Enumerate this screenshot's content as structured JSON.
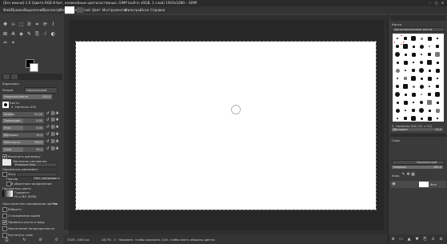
{
  "window": {
    "title": "[Без имени]-1.0 (Цвета RGB 8 бит, нелинейные цветосоставные, GIMP built-in sRGB, 1 слой) 1920x1080 – GIMP",
    "controls": [
      "–",
      "▢",
      "✕"
    ]
  },
  "menu": [
    "Файл",
    "Правка",
    "Выделение",
    "Просмотр",
    "Изображение",
    "Слой",
    "Цвет",
    "Инструменты",
    "Фильтры",
    "Окна",
    "Справка"
  ],
  "tool_options": {
    "title": "Карандаш",
    "mode_label": "Режим",
    "mode_value": "Нормальный",
    "opacity_label": "Непрозрачность",
    "opacity_value": "100,0",
    "brush_label": "Кисть",
    "brush_name": "2. Hardness 050",
    "sliders": [
      {
        "label": "Размер",
        "value": "51,00"
      },
      {
        "label": "Пропорции",
        "value": "0,00"
      },
      {
        "label": "Угол",
        "value": "0,00"
      },
      {
        "label": "Интервал",
        "value": "10,0"
      },
      {
        "label": "Жёсткость",
        "value": "100,0"
      },
      {
        "label": "Сила",
        "value": "50,0"
      }
    ],
    "dynamics_label": "Включить динамику",
    "dynamics_name": "Динамика рисования",
    "dynamics_sub": "Pressure Size",
    "dynamics_params": "Параметры динамики",
    "fade_label": "Затухание",
    "repeat_label": "Повтор",
    "repeat_value": "Нет, расширить",
    "reverse_label": "В обратном направлении",
    "color_options": "Параметры цвета",
    "gradient_label": "Градиент",
    "gradient_name": "FG в BG (RGB)",
    "blend_label": "Пространство смешивания цветов",
    "blend_value": "Ри",
    "options": [
      {
        "label": "Вибрато",
        "checked": false
      },
      {
        "label": "Сглаживание краёв",
        "checked": false
      },
      {
        "label": "Привязка кисти к виду",
        "checked": true
      },
      {
        "label": "Накопление непрозрачности",
        "checked": false
      },
      {
        "label": "Растянуть слой",
        "checked": false
      }
    ]
  },
  "status": {
    "coords": "3325, 1000",
    "unit": "px",
    "zoom": "18,7%",
    "hint": "Нажмите, чтобы рисовать (Ctrl, чтобы взять образец цвета)"
  },
  "dock": {
    "brushes_title": "Кисти",
    "brushes_filter": "Дополнительные кисти",
    "brush_caption": "2. Hardness 050 (51 × 51)",
    "spacing_label": "Интервал",
    "spacing_value": "10,0",
    "layers_title": "Слои",
    "mode_value": "Нормальный",
    "opacity_label": "Непрозр.",
    "opacity_value": "100,0",
    "lock_label": "Блок.",
    "layer_name": "Фон"
  },
  "colors": {
    "accent": "#ffffff",
    "dark": "#2a2a2a",
    "panel": "#3a3a3a"
  }
}
